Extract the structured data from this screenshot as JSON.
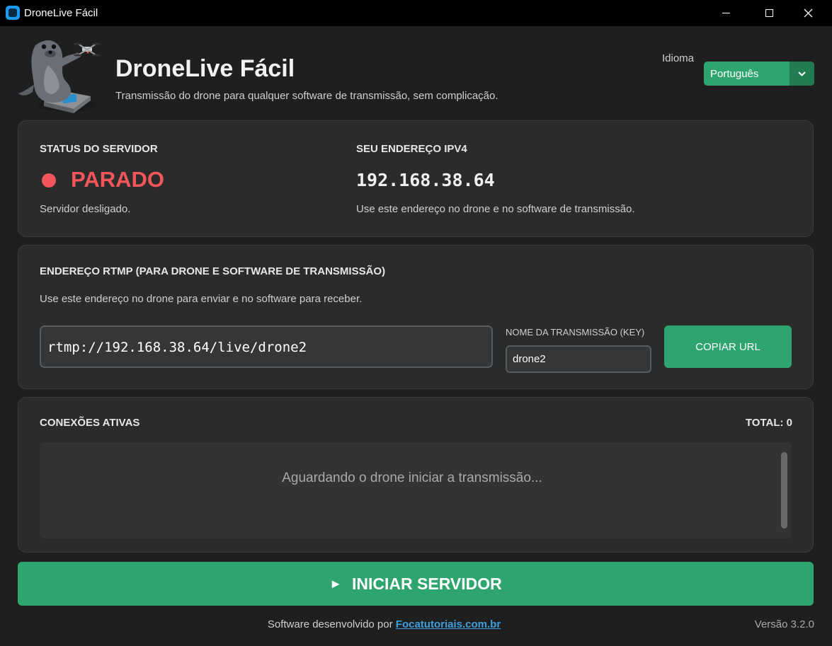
{
  "window": {
    "title": "DroneLive Fácil",
    "icon": "app-icon"
  },
  "header": {
    "title": "DroneLive Fácil",
    "subtitle": "Transmissão do drone para qualquer software de transmissão, sem complicação.",
    "logo": "seal-with-drone-logo",
    "language": {
      "label": "Idioma",
      "selected": "Português"
    }
  },
  "status_card": {
    "server_label": "STATUS DO SERVIDOR",
    "server_status": "PARADO",
    "server_status_color": "#f2555a",
    "server_note": "Servidor desligado.",
    "ip_label": "SEU ENDEREÇO IPV4",
    "ip_value": "192.168.38.64",
    "ip_note": "Use este endereço no drone e no software de transmissão."
  },
  "rtmp_card": {
    "title": "ENDEREÇO RTMP (PARA DRONE E SOFTWARE DE TRANSMISSÃO)",
    "description": "Use este endereço no drone para enviar e no software para receber.",
    "url": "rtmp://192.168.38.64/live/drone2",
    "key_label": "NOME DA TRANSMISSÃO (KEY)",
    "key_value": "drone2",
    "copy_button": "COPIAR URL"
  },
  "connections_card": {
    "title": "CONEXÕES ATIVAS",
    "total": "TOTAL: 0",
    "empty_message": "Aguardando o drone iniciar a transmissão..."
  },
  "start_button": {
    "icon": "play-icon",
    "label": "INICIAR SERVIDOR"
  },
  "footer": {
    "prefix": "Software desenvolvido por",
    "link_text": "Focatutoriais.com.br",
    "version": "Versão 3.2.0"
  },
  "colors": {
    "accent": "#2ea56e",
    "danger": "#f2555a",
    "link": "#3ca0e0"
  }
}
